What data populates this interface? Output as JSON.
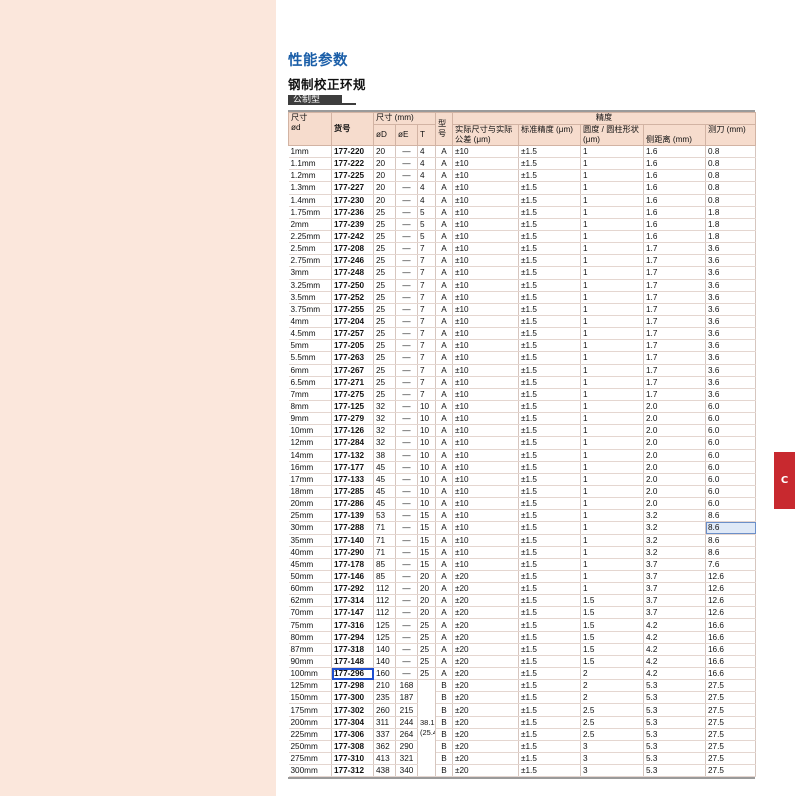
{
  "page": {
    "side_tab": "C"
  },
  "section_title": "性能参数",
  "product_title": "钢制校正环规",
  "type_tag": "公制型",
  "table": {
    "headers": {
      "size_1": "尺寸",
      "size_2": "ød",
      "code": "货号",
      "dims": "尺寸 (mm)",
      "dims_d": "øD",
      "dims_e": "øE",
      "dims_t": "T",
      "model": "型号",
      "precision": "精度",
      "actual_dev": "实际尺寸与实际公差 (μm)",
      "std_prec": "标准精度 (μm)",
      "roundness": "圆度 / 圆柱形状 (μm)",
      "edge_dist": "侧距离 (mm)",
      "measure": "测刀 (mm)"
    },
    "dash": "—",
    "merged_t": "38.1 (25.4)",
    "rows": [
      [
        "1mm",
        "177-220",
        "20",
        "—",
        "4",
        "A",
        "±10",
        "±1.5",
        "1",
        "1.6",
        "0.8"
      ],
      [
        "1.1mm",
        "177-222",
        "20",
        "—",
        "4",
        "A",
        "±10",
        "±1.5",
        "1",
        "1.6",
        "0.8"
      ],
      [
        "1.2mm",
        "177-225",
        "20",
        "—",
        "4",
        "A",
        "±10",
        "±1.5",
        "1",
        "1.6",
        "0.8"
      ],
      [
        "1.3mm",
        "177-227",
        "20",
        "—",
        "4",
        "A",
        "±10",
        "±1.5",
        "1",
        "1.6",
        "0.8"
      ],
      [
        "1.4mm",
        "177-230",
        "20",
        "—",
        "4",
        "A",
        "±10",
        "±1.5",
        "1",
        "1.6",
        "0.8"
      ],
      [
        "1.75mm",
        "177-236",
        "25",
        "—",
        "5",
        "A",
        "±10",
        "±1.5",
        "1",
        "1.6",
        "1.8"
      ],
      [
        "2mm",
        "177-239",
        "25",
        "—",
        "5",
        "A",
        "±10",
        "±1.5",
        "1",
        "1.6",
        "1.8"
      ],
      [
        "2.25mm",
        "177-242",
        "25",
        "—",
        "5",
        "A",
        "±10",
        "±1.5",
        "1",
        "1.6",
        "1.8"
      ],
      [
        "2.5mm",
        "177-208",
        "25",
        "—",
        "7",
        "A",
        "±10",
        "±1.5",
        "1",
        "1.7",
        "3.6"
      ],
      [
        "2.75mm",
        "177-246",
        "25",
        "—",
        "7",
        "A",
        "±10",
        "±1.5",
        "1",
        "1.7",
        "3.6"
      ],
      [
        "3mm",
        "177-248",
        "25",
        "—",
        "7",
        "A",
        "±10",
        "±1.5",
        "1",
        "1.7",
        "3.6"
      ],
      [
        "3.25mm",
        "177-250",
        "25",
        "—",
        "7",
        "A",
        "±10",
        "±1.5",
        "1",
        "1.7",
        "3.6"
      ],
      [
        "3.5mm",
        "177-252",
        "25",
        "—",
        "7",
        "A",
        "±10",
        "±1.5",
        "1",
        "1.7",
        "3.6"
      ],
      [
        "3.75mm",
        "177-255",
        "25",
        "—",
        "7",
        "A",
        "±10",
        "±1.5",
        "1",
        "1.7",
        "3.6"
      ],
      [
        "4mm",
        "177-204",
        "25",
        "—",
        "7",
        "A",
        "±10",
        "±1.5",
        "1",
        "1.7",
        "3.6"
      ],
      [
        "4.5mm",
        "177-257",
        "25",
        "—",
        "7",
        "A",
        "±10",
        "±1.5",
        "1",
        "1.7",
        "3.6"
      ],
      [
        "5mm",
        "177-205",
        "25",
        "—",
        "7",
        "A",
        "±10",
        "±1.5",
        "1",
        "1.7",
        "3.6"
      ],
      [
        "5.5mm",
        "177-263",
        "25",
        "—",
        "7",
        "A",
        "±10",
        "±1.5",
        "1",
        "1.7",
        "3.6"
      ],
      [
        "6mm",
        "177-267",
        "25",
        "—",
        "7",
        "A",
        "±10",
        "±1.5",
        "1",
        "1.7",
        "3.6"
      ],
      [
        "6.5mm",
        "177-271",
        "25",
        "—",
        "7",
        "A",
        "±10",
        "±1.5",
        "1",
        "1.7",
        "3.6"
      ],
      [
        "7mm",
        "177-275",
        "25",
        "—",
        "7",
        "A",
        "±10",
        "±1.5",
        "1",
        "1.7",
        "3.6"
      ],
      [
        "8mm",
        "177-125",
        "32",
        "—",
        "10",
        "A",
        "±10",
        "±1.5",
        "1",
        "2.0",
        "6.0"
      ],
      [
        "9mm",
        "177-279",
        "32",
        "—",
        "10",
        "A",
        "±10",
        "±1.5",
        "1",
        "2.0",
        "6.0"
      ],
      [
        "10mm",
        "177-126",
        "32",
        "—",
        "10",
        "A",
        "±10",
        "±1.5",
        "1",
        "2.0",
        "6.0"
      ],
      [
        "12mm",
        "177-284",
        "32",
        "—",
        "10",
        "A",
        "±10",
        "±1.5",
        "1",
        "2.0",
        "6.0"
      ],
      [
        "14mm",
        "177-132",
        "38",
        "—",
        "10",
        "A",
        "±10",
        "±1.5",
        "1",
        "2.0",
        "6.0"
      ],
      [
        "16mm",
        "177-177",
        "45",
        "—",
        "10",
        "A",
        "±10",
        "±1.5",
        "1",
        "2.0",
        "6.0"
      ],
      [
        "17mm",
        "177-133",
        "45",
        "—",
        "10",
        "A",
        "±10",
        "±1.5",
        "1",
        "2.0",
        "6.0"
      ],
      [
        "18mm",
        "177-285",
        "45",
        "—",
        "10",
        "A",
        "±10",
        "±1.5",
        "1",
        "2.0",
        "6.0"
      ],
      [
        "20mm",
        "177-286",
        "45",
        "—",
        "10",
        "A",
        "±10",
        "±1.5",
        "1",
        "2.0",
        "6.0"
      ],
      [
        "25mm",
        "177-139",
        "53",
        "—",
        "15",
        "A",
        "±10",
        "±1.5",
        "1",
        "3.2",
        "8.6"
      ],
      [
        "30mm",
        "177-288",
        "71",
        "—",
        "15",
        "A",
        "±10",
        "±1.5",
        "1",
        "3.2",
        "8.6"
      ],
      [
        "35mm",
        "177-140",
        "71",
        "—",
        "15",
        "A",
        "±10",
        "±1.5",
        "1",
        "3.2",
        "8.6"
      ],
      [
        "40mm",
        "177-290",
        "71",
        "—",
        "15",
        "A",
        "±10",
        "±1.5",
        "1",
        "3.2",
        "8.6"
      ],
      [
        "45mm",
        "177-178",
        "85",
        "—",
        "15",
        "A",
        "±10",
        "±1.5",
        "1",
        "3.7",
        "7.6"
      ],
      [
        "50mm",
        "177-146",
        "85",
        "—",
        "20",
        "A",
        "±20",
        "±1.5",
        "1",
        "3.7",
        "12.6"
      ],
      [
        "60mm",
        "177-292",
        "112",
        "—",
        "20",
        "A",
        "±20",
        "±1.5",
        "1",
        "3.7",
        "12.6"
      ],
      [
        "62mm",
        "177-314",
        "112",
        "—",
        "20",
        "A",
        "±20",
        "±1.5",
        "1.5",
        "3.7",
        "12.6"
      ],
      [
        "70mm",
        "177-147",
        "112",
        "—",
        "20",
        "A",
        "±20",
        "±1.5",
        "1.5",
        "3.7",
        "12.6"
      ],
      [
        "75mm",
        "177-316",
        "125",
        "—",
        "25",
        "A",
        "±20",
        "±1.5",
        "1.5",
        "4.2",
        "16.6"
      ],
      [
        "80mm",
        "177-294",
        "125",
        "—",
        "25",
        "A",
        "±20",
        "±1.5",
        "1.5",
        "4.2",
        "16.6"
      ],
      [
        "87mm",
        "177-318",
        "140",
        "—",
        "25",
        "A",
        "±20",
        "±1.5",
        "1.5",
        "4.2",
        "16.6"
      ],
      [
        "90mm",
        "177-148",
        "140",
        "—",
        "25",
        "A",
        "±20",
        "±1.5",
        "1.5",
        "4.2",
        "16.6"
      ],
      [
        "100mm",
        "177-296",
        "160",
        "—",
        "25",
        "A",
        "±20",
        "±1.5",
        "2",
        "4.2",
        "16.6"
      ],
      [
        "125mm",
        "177-298",
        "210",
        "168",
        "",
        "B",
        "±20",
        "±1.5",
        "2",
        "5.3",
        "27.5"
      ],
      [
        "150mm",
        "177-300",
        "235",
        "187",
        "",
        "B",
        "±20",
        "±1.5",
        "2",
        "5.3",
        "27.5"
      ],
      [
        "175mm",
        "177-302",
        "260",
        "215",
        "",
        "B",
        "±20",
        "±1.5",
        "2.5",
        "5.3",
        "27.5"
      ],
      [
        "200mm",
        "177-304",
        "311",
        "244",
        "",
        "B",
        "±20",
        "±1.5",
        "2.5",
        "5.3",
        "27.5"
      ],
      [
        "225mm",
        "177-306",
        "337",
        "264",
        "",
        "B",
        "±20",
        "±1.5",
        "2.5",
        "5.3",
        "27.5"
      ],
      [
        "250mm",
        "177-308",
        "362",
        "290",
        "",
        "B",
        "±20",
        "±1.5",
        "3",
        "5.3",
        "27.5"
      ],
      [
        "275mm",
        "177-310",
        "413",
        "321",
        "",
        "B",
        "±20",
        "±1.5",
        "3",
        "5.3",
        "27.5"
      ],
      [
        "300mm",
        "177-312",
        "438",
        "340",
        "",
        "B",
        "±20",
        "±1.5",
        "3",
        "5.3",
        "27.5"
      ]
    ],
    "selected_code": "177-296",
    "highlighted_cell": {
      "row": 31,
      "col": 10
    }
  }
}
